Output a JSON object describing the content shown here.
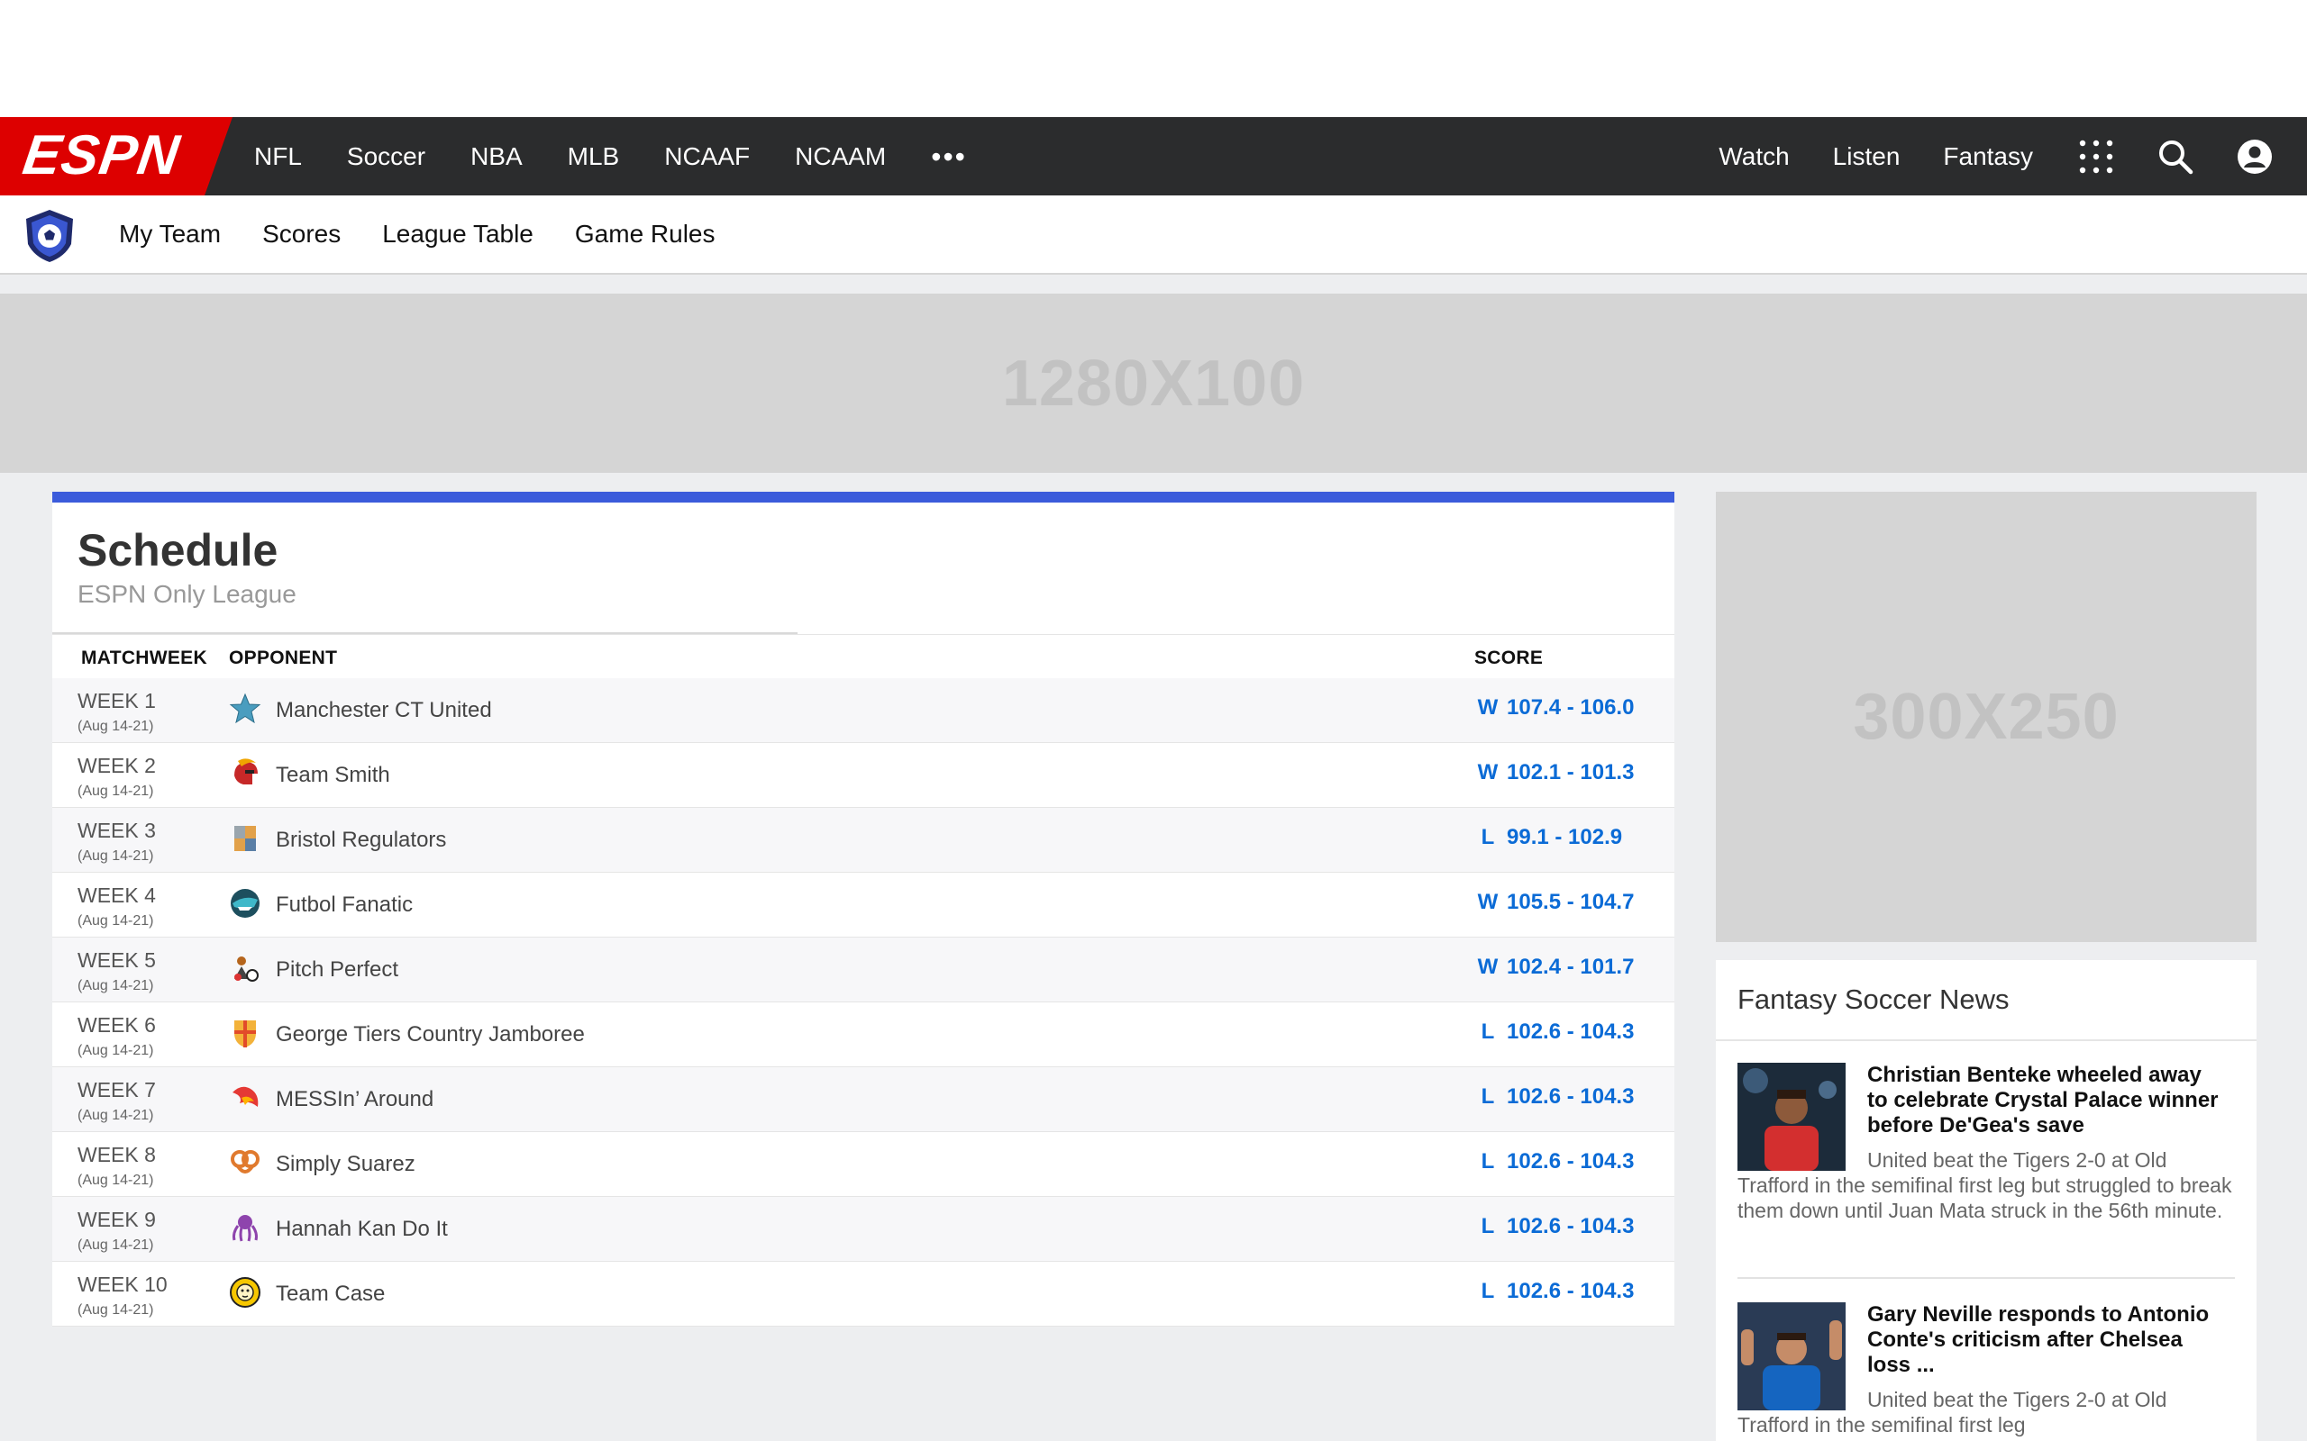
{
  "global_nav": {
    "logo": "ESPN",
    "left_items": [
      "NFL",
      "Soccer",
      "NBA",
      "MLB",
      "NCAAF",
      "NCAAM"
    ],
    "more": "•••",
    "right_items": [
      "Watch",
      "Listen",
      "Fantasy"
    ]
  },
  "sub_nav": {
    "items": [
      "My Team",
      "Scores",
      "League Table",
      "Game Rules"
    ]
  },
  "ads": {
    "leaderboard": "1280X100",
    "rail": "300X250"
  },
  "schedule": {
    "title": "Schedule",
    "subtitle": "ESPN Only League",
    "columns": [
      "MATCHWEEK",
      "OPPONENT",
      "SCORE"
    ],
    "rows": [
      {
        "week": "WEEK 1",
        "dates": "(Aug 14-21)",
        "team": "Manchester CT United",
        "result": "W",
        "score": "107.4 - 106.0",
        "icon": "star-icon"
      },
      {
        "week": "WEEK 2",
        "dates": "(Aug 14-21)",
        "team": "Team Smith",
        "result": "W",
        "score": "102.1 - 101.3",
        "icon": "spartan-helmet-icon"
      },
      {
        "week": "WEEK 3",
        "dates": "(Aug 14-21)",
        "team": "Bristol Regulators",
        "result": "L",
        "score": "99.1 - 102.9",
        "icon": "checkered-crest-icon"
      },
      {
        "week": "WEEK 4",
        "dates": "(Aug 14-21)",
        "team": "Futbol Fanatic",
        "result": "W",
        "score": "105.5 - 104.7",
        "icon": "shark-icon"
      },
      {
        "week": "WEEK 5",
        "dates": "(Aug 14-21)",
        "team": "Pitch Perfect",
        "result": "W",
        "score": "102.4 - 101.7",
        "icon": "pitch-icon"
      },
      {
        "week": "WEEK 6",
        "dates": "(Aug 14-21)",
        "team": "George Tiers Country Jamboree",
        "result": "L",
        "score": "102.6 - 104.3",
        "icon": "shield-crest-icon"
      },
      {
        "week": "WEEK 7",
        "dates": "(Aug 14-21)",
        "team": "MESSIn’ Around",
        "result": "L",
        "score": "102.6 - 104.3",
        "icon": "flame-icon"
      },
      {
        "week": "WEEK 8",
        "dates": "(Aug 14-21)",
        "team": "Simply Suarez",
        "result": "L",
        "score": "102.6 - 104.3",
        "icon": "pretzel-icon"
      },
      {
        "week": "WEEK 9",
        "dates": "(Aug 14-21)",
        "team": "Hannah Kan Do It",
        "result": "L",
        "score": "102.6 - 104.3",
        "icon": "octopus-icon"
      },
      {
        "week": "WEEK 10",
        "dates": "(Aug 14-21)",
        "team": "Team Case",
        "result": "L",
        "score": "102.6 - 104.3",
        "icon": "lion-badge-icon"
      }
    ]
  },
  "news": {
    "title": "Fantasy Soccer News",
    "stories": [
      {
        "headline": "Christian Benteke wheeled away to celebrate Crystal Palace winner before De'Gea's save",
        "body": "United beat the Tigers 2-0 at Old Trafford in the semifinal first leg but struggled to break them down until Juan Mata struck in the 56th minute."
      },
      {
        "headline": "Gary Neville responds to Antonio Conte's criticism after Chelsea loss ...",
        "body": "United beat the Tigers 2-0 at Old Trafford in the semifinal first leg"
      }
    ]
  },
  "colors": {
    "espn_red": "#dd0000",
    "nav_bg": "#2b2c2d",
    "accent_blue": "#3b5bdb",
    "score_blue": "#0b6bd6"
  }
}
